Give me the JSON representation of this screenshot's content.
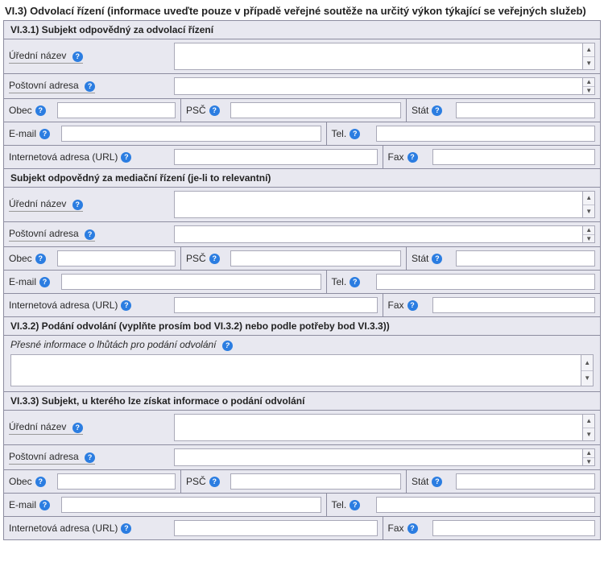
{
  "section_title": "VI.3) Odvolací řízení (informace uveďte pouze v případě veřejné soutěže na určitý výkon týkající se veřejných služeb)",
  "vi31": {
    "header": "VI.3.1) Subjekt odpovědný za odvolací řízení",
    "labels": {
      "nazev": "Úřední název",
      "adresa": "Poštovní adresa",
      "obec": "Obec",
      "psc": "PSČ",
      "stat": "Stát",
      "email": "E-mail",
      "tel": "Tel.",
      "url": "Internetová adresa (URL)",
      "fax": "Fax"
    },
    "values": {
      "nazev": "",
      "adresa": "",
      "obec": "",
      "psc": "",
      "stat": "",
      "email": "",
      "tel": "",
      "url": "",
      "fax": ""
    }
  },
  "mediace": {
    "header": "Subjekt odpovědný za mediační řízení (je-li to relevantní)",
    "labels": {
      "nazev": "Úřední název",
      "adresa": "Poštovní adresa",
      "obec": "Obec",
      "psc": "PSČ",
      "stat": "Stát",
      "email": "E-mail",
      "tel": "Tel.",
      "url": "Internetová adresa (URL)",
      "fax": "Fax"
    },
    "values": {
      "nazev": "",
      "adresa": "",
      "obec": "",
      "psc": "",
      "stat": "",
      "email": "",
      "tel": "",
      "url": "",
      "fax": ""
    }
  },
  "vi32": {
    "header": "VI.3.2) Podání odvolání (vyplňte prosím bod VI.3.2) nebo podle potřeby bod VI.3.3))",
    "label": "Přesné informace o lhůtách pro podání odvolání",
    "value": ""
  },
  "vi33": {
    "header": "VI.3.3) Subjekt, u kterého lze získat informace o podání odvolání",
    "labels": {
      "nazev": "Úřední název",
      "adresa": "Poštovní adresa",
      "obec": "Obec",
      "psc": "PSČ",
      "stat": "Stát",
      "email": "E-mail",
      "tel": "Tel.",
      "url": "Internetová adresa (URL)",
      "fax": "Fax"
    },
    "values": {
      "nazev": "",
      "adresa": "",
      "obec": "",
      "psc": "",
      "stat": "",
      "email": "",
      "tel": "",
      "url": "",
      "fax": ""
    }
  },
  "help_glyph": "?"
}
